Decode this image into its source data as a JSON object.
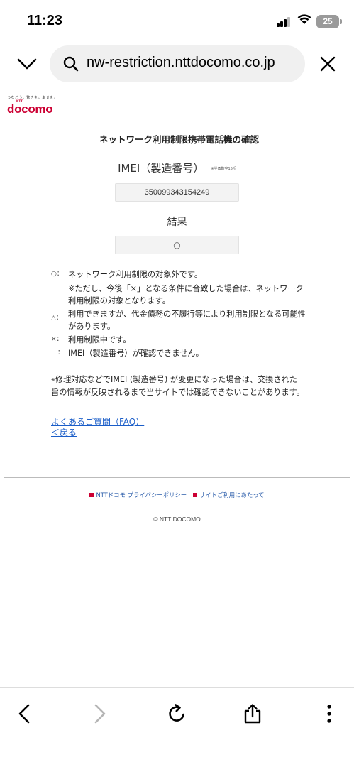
{
  "status_bar": {
    "time": "11:23",
    "battery": "25"
  },
  "browser": {
    "url": "nw-restriction.nttdocomo.co.jp",
    "icons": {
      "collapse": "chevron-down-icon",
      "search": "search-icon",
      "close": "close-icon"
    }
  },
  "header": {
    "tagline": "つなごう。驚きを。幸せを。",
    "logo_small": "NTT",
    "logo": "docomo"
  },
  "main": {
    "title": "ネットワーク利用制限携帯電話機の確認",
    "imei_label": "IMEI（製造番号）",
    "imei_note": "※半角数字15桁",
    "imei_value": "350099343154249",
    "result_label": "結果",
    "result_value": "○"
  },
  "legend": {
    "circle_mark": "○：",
    "circle_text": "ネットワーク利用制限の対象外です。",
    "circle_sub": "※ただし、今後「×」となる条件に合致した場合は、ネットワーク利用制限の対象となります。",
    "triangle_mark": "△：",
    "triangle_text": "利用できますが、代金債務の不履行等により利用制限となる可能性があります。",
    "cross_mark": "×：",
    "cross_text": "利用制限中です。",
    "dash_mark": "－：",
    "dash_text": "IMEI（製造番号）が確認できません。"
  },
  "note": {
    "mark": "※",
    "text": "修理対応などでIMEI (製造番号) が変更になった場合は、交換された旨の情報が反映されるまで当サイトでは確認できないことがあります。"
  },
  "links": {
    "faq": "よくあるご質問（FAQ）",
    "back": "＜戻る"
  },
  "footer": {
    "privacy": "NTTドコモ プライバシーポリシー",
    "terms": "サイトご利用にあたって",
    "copyright": "© NTT DOCOMO"
  },
  "colors": {
    "brand": "#cc0033",
    "link": "#1a5dc8"
  },
  "bottom_nav": [
    "back-arrow-icon",
    "forward-arrow-icon",
    "reload-icon",
    "share-icon",
    "more-icon"
  ]
}
